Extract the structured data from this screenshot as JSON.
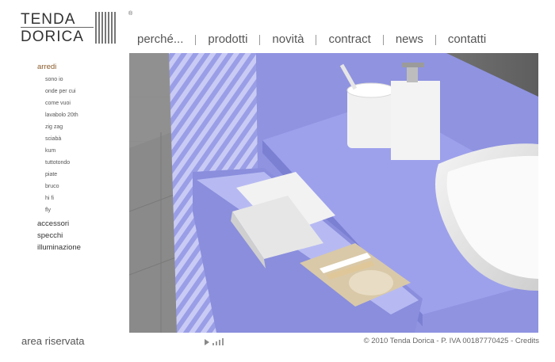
{
  "brand": {
    "line1": "TENDA",
    "line2": "DORICA",
    "reg": "®"
  },
  "topnav": [
    "perché...",
    "prodotti",
    "novità",
    "contract",
    "news",
    "contatti"
  ],
  "sidebar": {
    "categories": [
      {
        "label": "arredi",
        "active": true,
        "subitems": [
          "sono io",
          "onde per cui",
          "come vuoi",
          "lavabolo 20th",
          "zig zag",
          "sciabà",
          "kum",
          "tuttotondo",
          "piate",
          "bruco",
          "hi fi",
          "fly"
        ]
      },
      {
        "label": "accessori",
        "active": false,
        "subitems": []
      },
      {
        "label": "specchi",
        "active": false,
        "subitems": []
      },
      {
        "label": "illuminazione",
        "active": false,
        "subitems": []
      }
    ]
  },
  "footer": {
    "area": "area riservata",
    "copyright": "© 2010 Tenda Dorica - P. IVA 00187770425 - ",
    "credits": "Credits"
  },
  "colors": {
    "accent_active": "#8a5a2a",
    "furniture": "#8f93e0",
    "floor": "#8c8c8c"
  }
}
